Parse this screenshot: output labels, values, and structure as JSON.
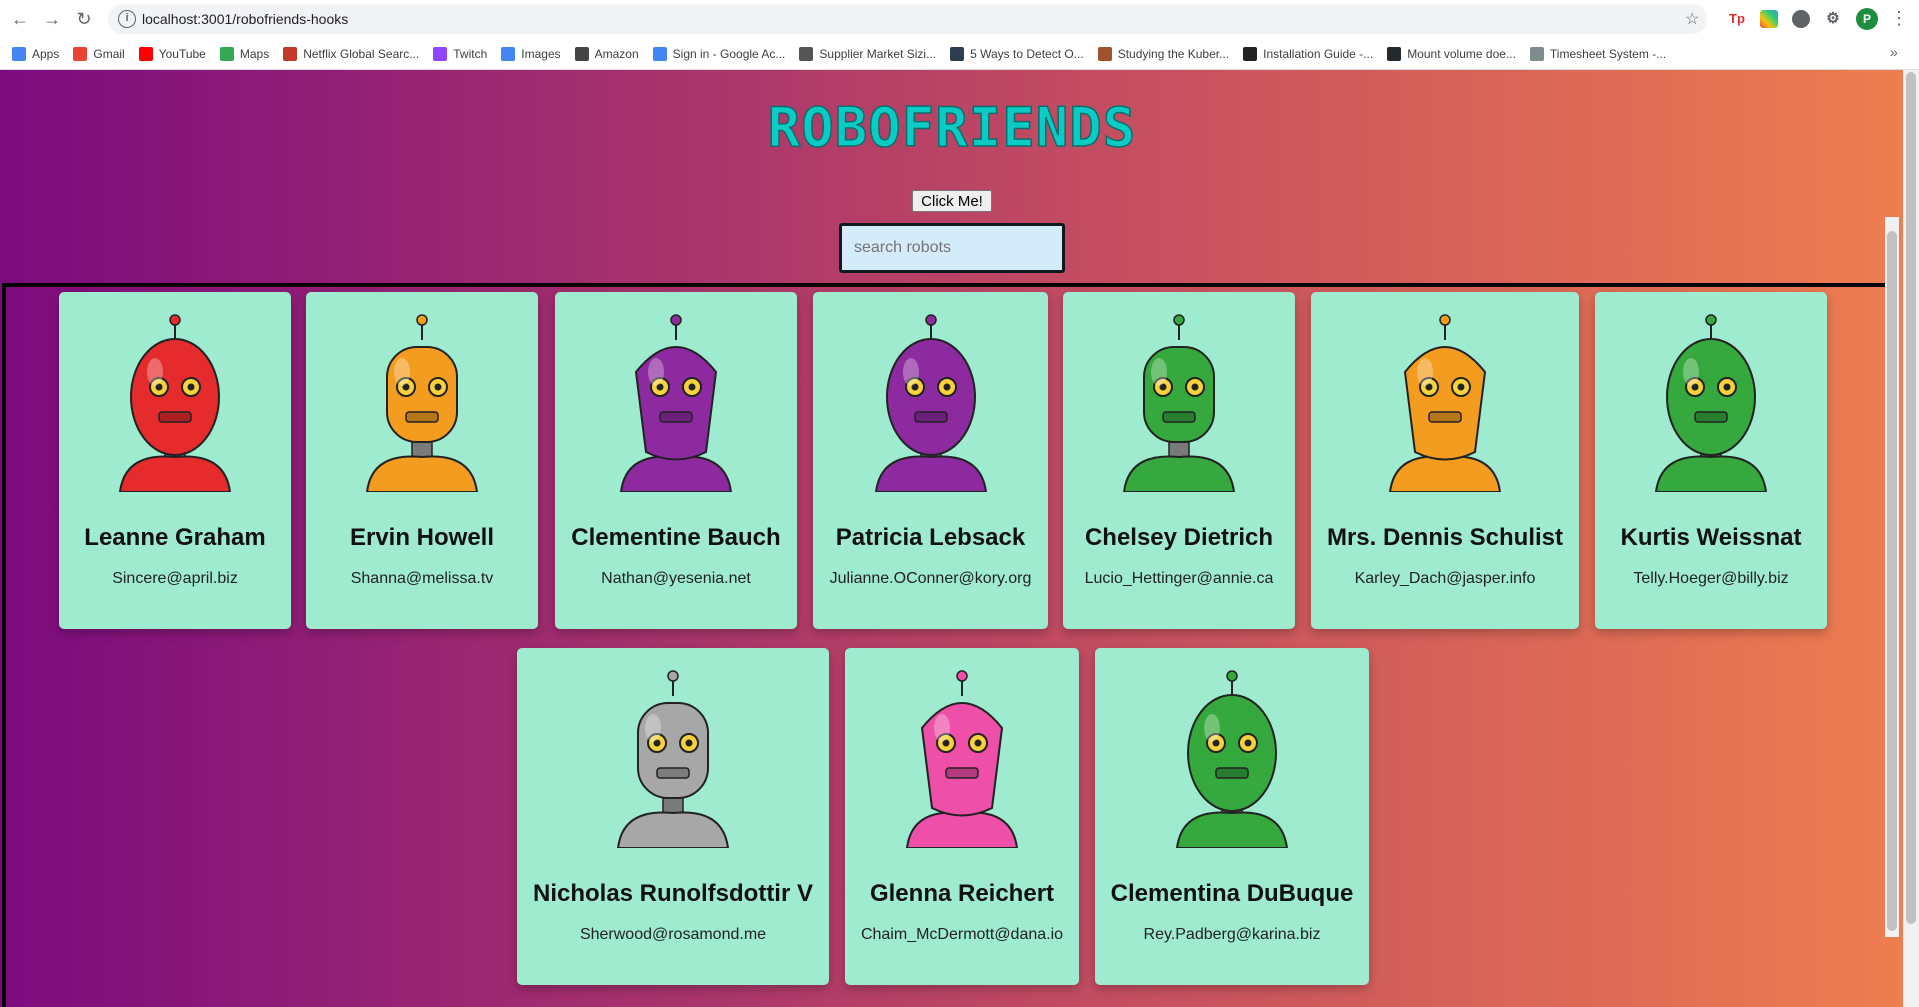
{
  "browser": {
    "url": "localhost:3001/robofriends-hooks",
    "bookmarks": [
      {
        "label": "Apps",
        "icon": "apps-icon",
        "color": "#4285f4"
      },
      {
        "label": "Gmail",
        "icon": "gmail-icon",
        "color": "#ea4335"
      },
      {
        "label": "YouTube",
        "icon": "youtube-icon",
        "color": "#ff0000"
      },
      {
        "label": "Maps",
        "icon": "maps-icon",
        "color": "#34a853"
      },
      {
        "label": "Netflix Global Searc...",
        "icon": "unogs-icon",
        "color": "#c0392b"
      },
      {
        "label": "Twitch",
        "icon": "twitch-icon",
        "color": "#9146ff"
      },
      {
        "label": "Images",
        "icon": "google-icon",
        "color": "#4285f4"
      },
      {
        "label": "Amazon",
        "icon": "amazon-icon",
        "color": "#444444"
      },
      {
        "label": "Sign in - Google Ac...",
        "icon": "google-icon",
        "color": "#4285f4"
      },
      {
        "label": "Supplier Market Sizi...",
        "icon": "globe-icon",
        "color": "#555555"
      },
      {
        "label": "5 Ways to Detect O...",
        "icon": "site-icon",
        "color": "#2c3e50"
      },
      {
        "label": "Studying the Kuber...",
        "icon": "person-icon",
        "color": "#a0522d"
      },
      {
        "label": "Installation Guide -...",
        "icon": "site-icon",
        "color": "#222222"
      },
      {
        "label": "Mount volume doe...",
        "icon": "github-icon",
        "color": "#24292e"
      },
      {
        "label": "Timesheet System -...",
        "icon": "doc-icon",
        "color": "#7f8c8d"
      }
    ],
    "profile_initial": "P"
  },
  "header": {
    "title": "ROBOFRIENDS",
    "button_label": "Click Me!",
    "search_placeholder": "search robots"
  },
  "robots": [
    {
      "name": "Leanne Graham",
      "email": "Sincere@april.biz",
      "color": "#e52b2b"
    },
    {
      "name": "Ervin Howell",
      "email": "Shanna@melissa.tv",
      "color": "#f39c1f"
    },
    {
      "name": "Clementine Bauch",
      "email": "Nathan@yesenia.net",
      "color": "#8e2aa0"
    },
    {
      "name": "Patricia Lebsack",
      "email": "Julianne.OConner@kory.org",
      "color": "#8e2aa0"
    },
    {
      "name": "Chelsey Dietrich",
      "email": "Lucio_Hettinger@annie.ca",
      "color": "#35a83e"
    },
    {
      "name": "Mrs. Dennis Schulist",
      "email": "Karley_Dach@jasper.info",
      "color": "#f39c1f"
    },
    {
      "name": "Kurtis Weissnat",
      "email": "Telly.Hoeger@billy.biz",
      "color": "#35a83e"
    },
    {
      "name": "Nicholas Runolfsdottir V",
      "email": "Sherwood@rosamond.me",
      "color": "#a7a7a7"
    },
    {
      "name": "Glenna Reichert",
      "email": "Chaim_McDermott@dana.io",
      "color": "#ee4fa8"
    },
    {
      "name": "Clementina DuBuque",
      "email": "Rey.Padberg@karina.biz",
      "color": "#35a83e"
    }
  ]
}
